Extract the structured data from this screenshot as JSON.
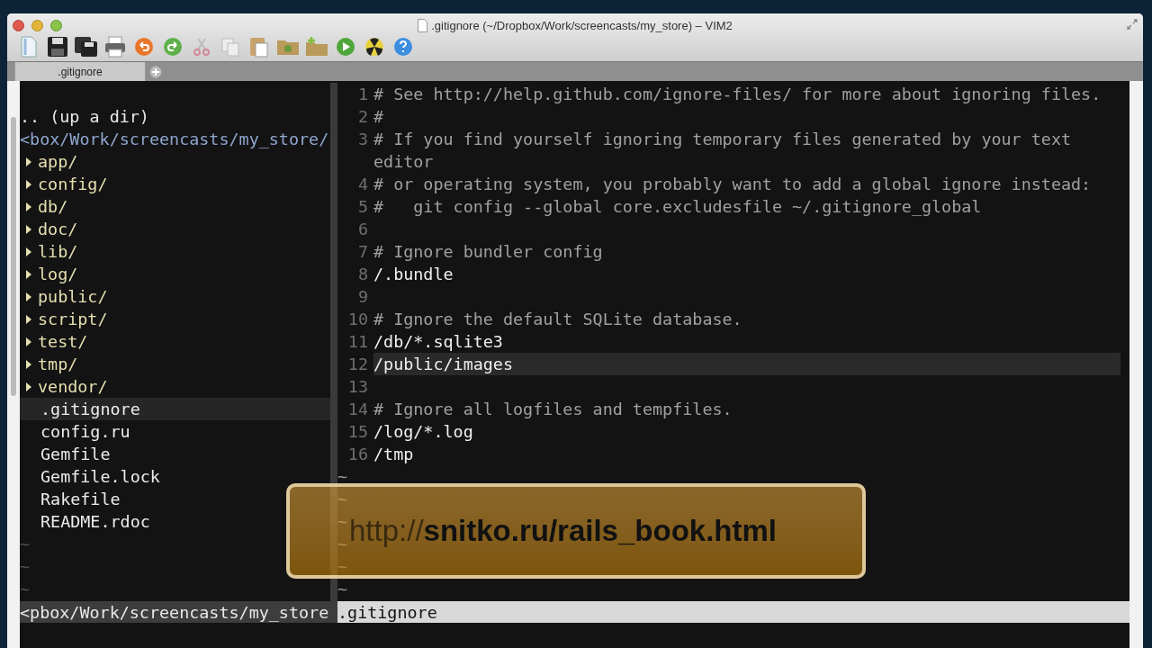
{
  "window": {
    "title": ".gitignore (~/Dropbox/Work/screencasts/my_store) – VIM2"
  },
  "tabs": [
    {
      "label": ".gitignore",
      "selected": true
    }
  ],
  "file_tree": {
    "items": [
      {
        "kind": "blank"
      },
      {
        "kind": "updir",
        "text": ".. (up a dir)"
      },
      {
        "kind": "path",
        "text": "<box/Work/screencasts/my_store/"
      },
      {
        "kind": "dir",
        "text": "app/",
        "expanded": false
      },
      {
        "kind": "dir",
        "text": "config/",
        "expanded": false
      },
      {
        "kind": "dir",
        "text": "db/",
        "expanded": false
      },
      {
        "kind": "dir",
        "text": "doc/",
        "expanded": false
      },
      {
        "kind": "dir",
        "text": "lib/",
        "expanded": false
      },
      {
        "kind": "dir",
        "text": "log/",
        "expanded": false
      },
      {
        "kind": "dir",
        "text": "public/",
        "expanded": false
      },
      {
        "kind": "dir",
        "text": "script/",
        "expanded": false
      },
      {
        "kind": "dir",
        "text": "test/",
        "expanded": false
      },
      {
        "kind": "dir",
        "text": "tmp/",
        "expanded": false
      },
      {
        "kind": "dir",
        "text": "vendor/",
        "expanded": false
      },
      {
        "kind": "file",
        "text": ".gitignore",
        "selected": true
      },
      {
        "kind": "file",
        "text": "config.ru",
        "selected": false
      },
      {
        "kind": "file",
        "text": "Gemfile",
        "selected": false
      },
      {
        "kind": "file",
        "text": "Gemfile.lock",
        "selected": false
      },
      {
        "kind": "file",
        "text": "Rakefile",
        "selected": false
      },
      {
        "kind": "file",
        "text": "README.rdoc",
        "selected": false
      },
      {
        "kind": "tilde",
        "text": "~"
      },
      {
        "kind": "tilde",
        "text": "~"
      },
      {
        "kind": "tilde",
        "text": "~"
      }
    ]
  },
  "editor": {
    "lines": [
      {
        "number": "1",
        "kind": "comment",
        "text": "# See http://help.github.com/ignore-files/ for more about ignoring files.",
        "selected": false
      },
      {
        "number": "2",
        "kind": "comment",
        "text": "#",
        "selected": false
      },
      {
        "number": "3",
        "kind": "comment",
        "text": "# If you find yourself ignoring temporary files generated by your text editor",
        "selected": false
      },
      {
        "number": "4",
        "kind": "comment",
        "text": "# or operating system, you probably want to add a global ignore instead:",
        "selected": false
      },
      {
        "number": "5",
        "kind": "comment",
        "text": "#   git config --global core.excludesfile ~/.gitignore_global",
        "selected": false
      },
      {
        "number": "6",
        "kind": "blank",
        "selected": false
      },
      {
        "number": "7",
        "kind": "comment",
        "text": "# Ignore bundler config",
        "selected": false
      },
      {
        "number": "8",
        "kind": "code",
        "text": "/.bundle",
        "selected": false
      },
      {
        "number": "9",
        "kind": "blank",
        "selected": false
      },
      {
        "number": "10",
        "kind": "comment",
        "text": "# Ignore the default SQLite database.",
        "selected": false
      },
      {
        "number": "11",
        "kind": "code",
        "text": "/db/*.sqlite3",
        "selected": false
      },
      {
        "number": "12",
        "kind": "code",
        "text": "/public/images",
        "selected": true
      },
      {
        "number": "13",
        "kind": "blank",
        "selected": false
      },
      {
        "number": "14",
        "kind": "comment",
        "text": "# Ignore all logfiles and tempfiles.",
        "selected": false
      },
      {
        "number": "15",
        "kind": "code",
        "text": "/log/*.log",
        "selected": false
      },
      {
        "number": "16",
        "kind": "code",
        "text": "/tmp",
        "selected": false
      }
    ],
    "tildes": [
      "~",
      "~",
      "~",
      "~",
      "~",
      "~"
    ]
  },
  "status_bar": {
    "left": "<pbox/Work/screencasts/my_store",
    "right": ".gitignore"
  },
  "banner": {
    "text": "http://**snitko.ru/rails_book.html**"
  }
}
